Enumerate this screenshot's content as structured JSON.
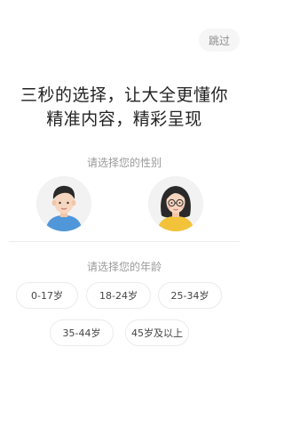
{
  "skip_label": "跳过",
  "headline": {
    "line1": "三秒的选择，让大全更懂你",
    "line2": "精准内容，精彩呈现"
  },
  "gender_section": {
    "label": "请选择您的性别",
    "options": [
      {
        "icon": "male-avatar-icon"
      },
      {
        "icon": "female-avatar-icon"
      }
    ]
  },
  "age_section": {
    "label": "请选择您的年龄",
    "options": [
      "0-17岁",
      "18-24岁",
      "25-34岁",
      "35-44岁",
      "45岁及以上"
    ]
  },
  "colors": {
    "male_shirt": "#4f97d9",
    "female_shirt": "#f2c33a",
    "skin": "#f7d6bf",
    "hair": "#2a2a2a"
  }
}
